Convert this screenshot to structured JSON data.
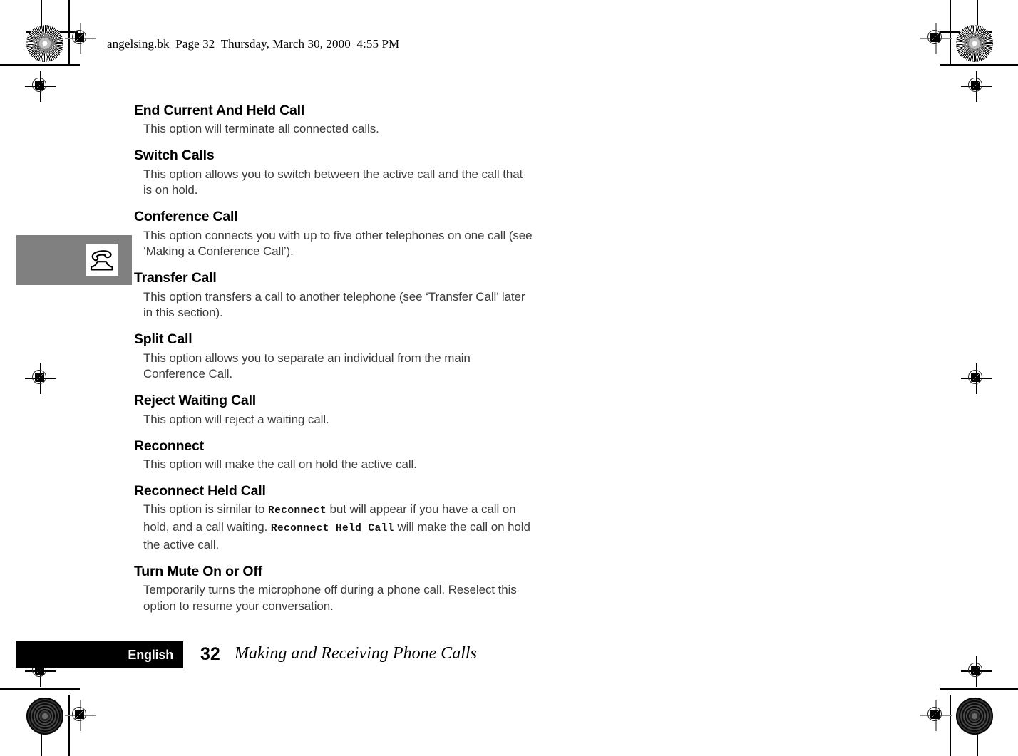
{
  "header": {
    "slug": "angelsing.bk  Page 32  Thursday, March 30, 2000  4:55 PM"
  },
  "side_tab": {
    "icon": "telephone-icon",
    "background_color": "#808080"
  },
  "content": {
    "sections": [
      {
        "heading": "End Current And Held Call",
        "body": "This option will terminate all connected calls."
      },
      {
        "heading": "Switch Calls",
        "body": "This option allows you to switch between the active call and the call that is on hold."
      },
      {
        "heading": "Conference Call",
        "body": "This option connects you with up to five other telephones on one call (see ‘Making a Conference Call’)."
      },
      {
        "heading": "Transfer Call",
        "body": "This option transfers a call to another telephone (see ‘Transfer Call’ later in this section)."
      },
      {
        "heading": "Split Call",
        "body": "This option allows you to separate an individual from the main Conference Call."
      },
      {
        "heading": "Reject Waiting Call",
        "body": "This option will reject a waiting call."
      },
      {
        "heading": "Reconnect",
        "body": "This option will make the call on hold the active call."
      },
      {
        "heading": "Reconnect Held Call",
        "body_part1": "This option is similar to ",
        "code1": "Reconnect",
        "body_part2": " but will appear if you have a call on hold, and a call waiting. ",
        "code2": "Reconnect Held Call",
        "body_part3": " will make the call on hold the active call."
      },
      {
        "heading": "Turn Mute On or Off",
        "body": "Temporarily turns the microphone off during a phone call. Reselect this option to resume your conversation."
      }
    ]
  },
  "footer": {
    "language": "English",
    "page_number": "32",
    "section_title": "Making and Receiving Phone Calls"
  },
  "colors": {
    "tab_gray": "#808080",
    "body_text": "#3c3c3c",
    "heading_text": "#000000",
    "footer_bar": "#000000"
  }
}
